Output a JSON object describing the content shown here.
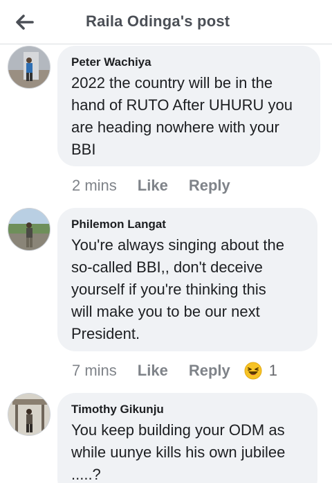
{
  "header": {
    "title": "Raila Odinga's post"
  },
  "comments": [
    {
      "author": "Peter Wachiya",
      "text": "2022 the country will be in the\nhand of RUTO After UHURU you\nare heading nowhere with your\nBBI",
      "time": "2 mins",
      "like_label": "Like",
      "reply_label": "Reply"
    },
    {
      "author": "Philemon Langat",
      "text": "You're always singing about the\nso-called BBI,, don't deceive\nyourself if you're thinking this\nwill make you to be our next\nPresident.",
      "time": "7 mins",
      "like_label": "Like",
      "reply_label": "Reply",
      "reaction": {
        "icon": "laughing-emoji-icon",
        "count": "1"
      }
    },
    {
      "author": "Timothy Gikunju",
      "text": "You keep building your ODM as\nwhile uunye kills his own jubilee\n.....?"
    }
  ],
  "colors": {
    "bubble": "#f0f2f5",
    "meta": "#7f8389",
    "title": "#4b4f56"
  }
}
